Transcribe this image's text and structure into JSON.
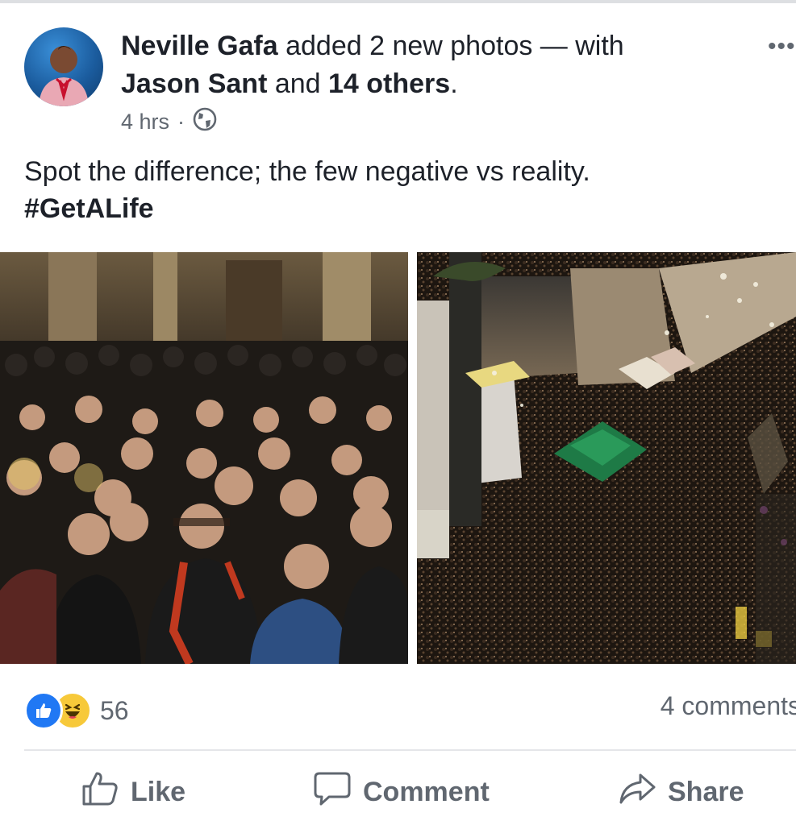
{
  "post": {
    "author": "Neville Gafa",
    "action_text": " added 2 new photos — with",
    "tagged_person": "Jason Sant",
    "tagged_joiner": " and ",
    "tagged_others": "14 others",
    "tagged_end": ".",
    "time": "4 hrs",
    "time_separator": "·",
    "privacy_icon": "globe-icon",
    "more_label": "•••",
    "text": "Spot the  difference; the few negative vs reality.",
    "hashtag": "#GetALife"
  },
  "photos": [
    {
      "description_icon": "photo-crowd-church"
    },
    {
      "description_icon": "photo-crowd-street"
    }
  ],
  "engagement": {
    "reaction_icons": [
      "like-reaction-icon",
      "haha-reaction-icon"
    ],
    "reaction_count": "56",
    "comments": "4 comments"
  },
  "actions": {
    "like": "Like",
    "comment": "Comment",
    "share": "Share"
  },
  "colors": {
    "like_blue": "#2078f4",
    "haha_yellow": "#f7c93a",
    "secondary_text": "#606770",
    "primary_text": "#1d2129"
  }
}
